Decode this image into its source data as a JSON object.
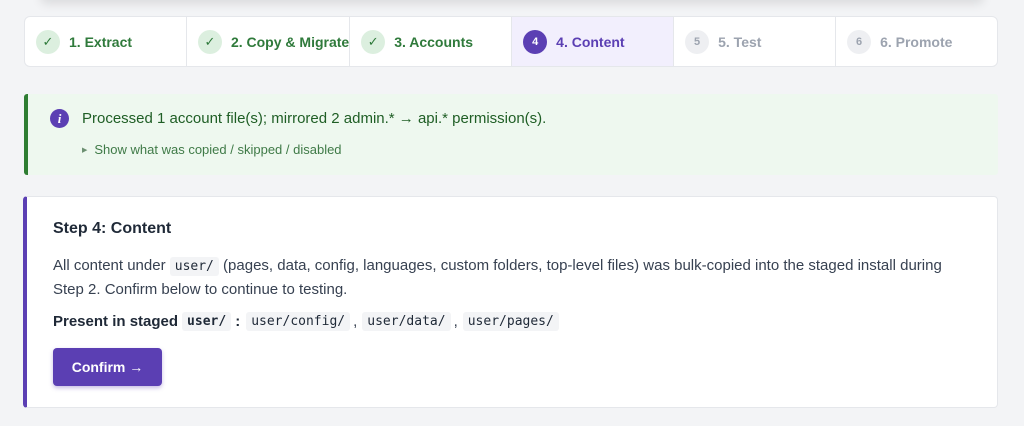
{
  "steps": [
    {
      "badge": "✓",
      "label": "1. Extract",
      "state": "done"
    },
    {
      "badge": "✓",
      "label": "2. Copy & Migrate",
      "state": "done"
    },
    {
      "badge": "✓",
      "label": "3. Accounts",
      "state": "done"
    },
    {
      "badge": "4",
      "label": "4. Content",
      "state": "active"
    },
    {
      "badge": "5",
      "label": "5. Test",
      "state": "pending"
    },
    {
      "badge": "6",
      "label": "6. Promote",
      "state": "pending"
    }
  ],
  "info": {
    "icon": "i",
    "message": "Processed 1 account file(s); mirrored 2 admin.* → api.* permission(s).",
    "details_label": "Show what was copied / skipped / disabled"
  },
  "card": {
    "title": "Step 4: Content",
    "desc_pre": "All content under ",
    "desc_code": "user/",
    "desc_post": " (pages, data, config, languages, custom folders, top-level files) was bulk-copied into the staged install during Step 2. Confirm below to continue to testing.",
    "present_label": "Present in staged",
    "present_code": "user/",
    "present_colon": ":",
    "present_dirs": [
      "user/config/",
      "user/data/",
      "user/pages/"
    ],
    "confirm_label": "Confirm →"
  },
  "colors": {
    "accent": "#5b3fb3",
    "success": "#2e7d32",
    "info_bg": "#eef8ef"
  }
}
